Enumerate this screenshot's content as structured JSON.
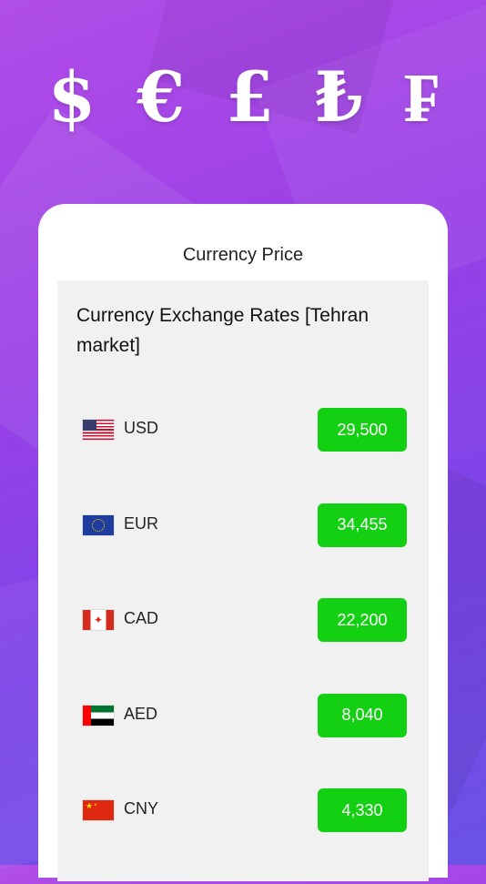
{
  "hero": {
    "symbols": [
      "$",
      "€",
      "£",
      "₺",
      "₣"
    ]
  },
  "card": {
    "title": "Currency Price",
    "heading": "Currency Exchange Rates [Tehran market]"
  },
  "currencies": [
    {
      "code": "USD",
      "price": "29,500",
      "flag": "us-flag-icon"
    },
    {
      "code": "EUR",
      "price": "34,455",
      "flag": "eu-flag-icon"
    },
    {
      "code": "CAD",
      "price": "22,200",
      "flag": "canada-flag-icon"
    },
    {
      "code": "AED",
      "price": "8,040",
      "flag": "uae-flag-icon"
    },
    {
      "code": "CNY",
      "price": "4,330",
      "flag": "china-flag-icon"
    }
  ],
  "colors": {
    "price_badge": "#13d012",
    "background_gradient": [
      "#b14ee8",
      "#6a52e6"
    ]
  }
}
